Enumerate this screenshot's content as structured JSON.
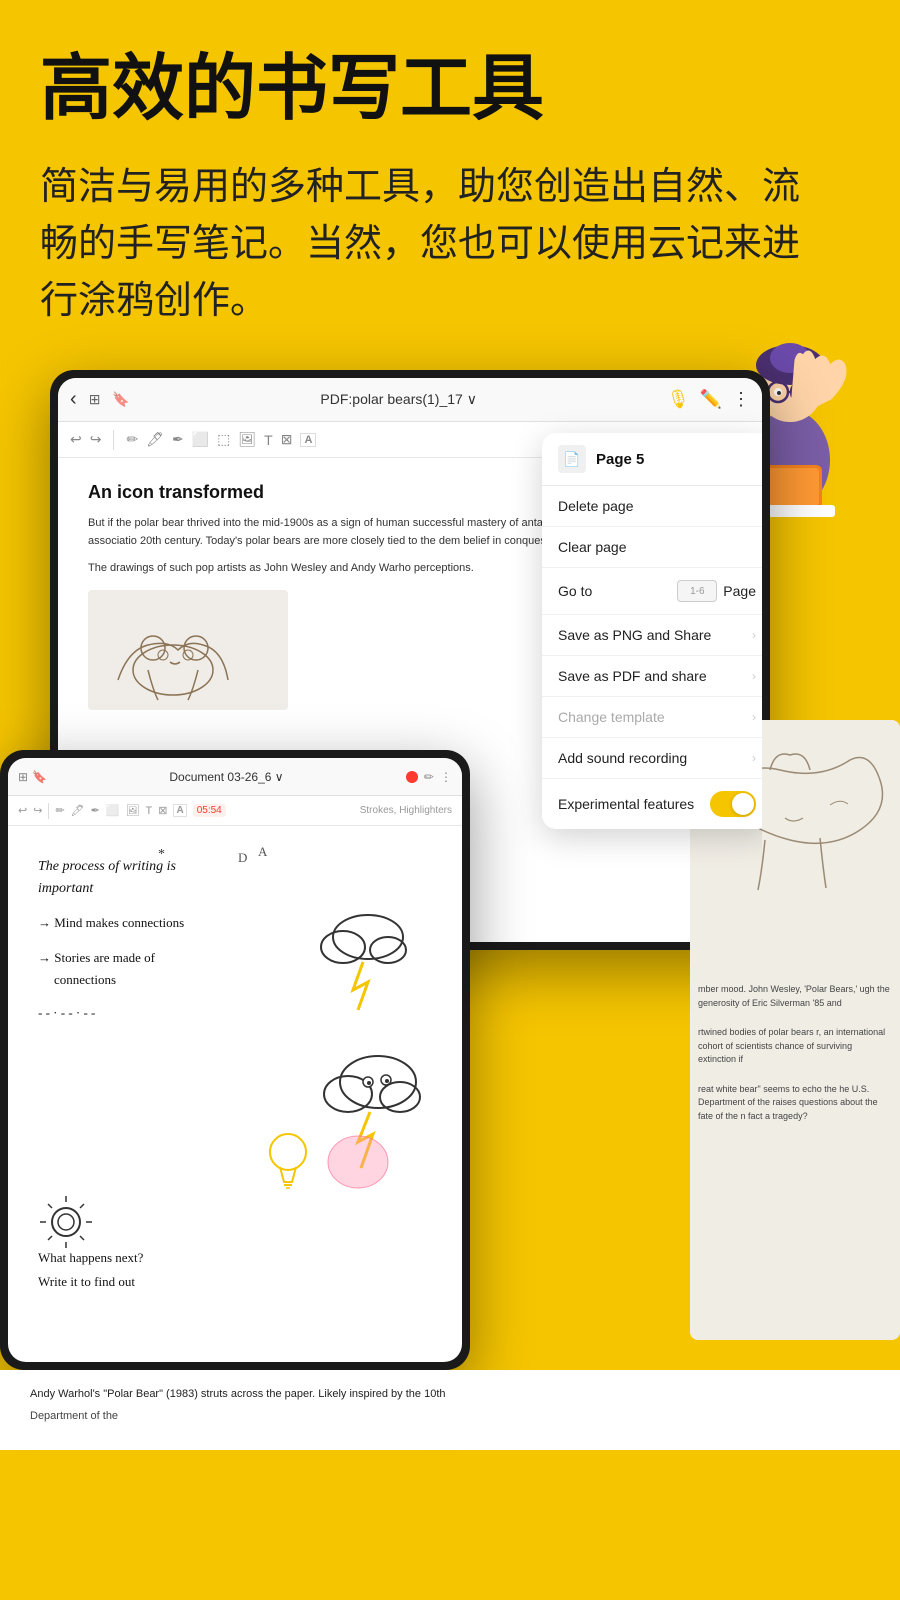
{
  "hero": {
    "title": "高效的书写工具",
    "description": "简洁与易用的多种工具，助您创造出自然、流畅的手写笔记。当然，您也可以使用云记来进行涂鸦创作。"
  },
  "toolbar": {
    "back_icon": "‹",
    "title": "PDF:polar bears(1)_17 ∨",
    "mic_icon": "🎙",
    "pen_icon": "✏",
    "dots_icon": "⋮"
  },
  "context_menu": {
    "header_title": "Page 5",
    "items": [
      {
        "label": "Delete page",
        "type": "normal",
        "right": ""
      },
      {
        "label": "Clear page",
        "type": "normal",
        "right": ""
      },
      {
        "label": "Go to",
        "type": "goto",
        "placeholder": "1-6",
        "page_label": "Page"
      },
      {
        "label": "Save as PNG and Share",
        "type": "arrow",
        "right": "›"
      },
      {
        "label": "Save as PDF and share",
        "type": "arrow",
        "right": "›"
      },
      {
        "label": "Change template",
        "type": "disabled_arrow",
        "right": "›"
      },
      {
        "label": "Add sound recording",
        "type": "arrow",
        "right": "›"
      },
      {
        "label": "Experimental features",
        "type": "toggle"
      }
    ]
  },
  "document": {
    "title": "An icon transformed",
    "paragraph1": "But if the polar bear thrived into the mid-1900s as a sign of human successful mastery of antagonistic forces, this symbolic associatio 20th century. Today's polar bears are more closely tied to the dem belief in conquest and domination.",
    "paragraph2": "The drawings of such pop artists as John Wesley and Andy Warho perceptions."
  },
  "second_tablet": {
    "title": "Document 03-26_6 ∨",
    "timer": "05:54",
    "strokes_label": "Strokes, Highlighters",
    "handwriting_lines": [
      "The process of writing is",
      "important",
      "→ Mind makes connections",
      "→ Stories are made of",
      "   connections",
      "- - · - - · - -",
      "What happens next?",
      "Write it to find out"
    ]
  },
  "pdf_panel": {
    "text1": "mber mood. John Wesley, 'Polar Bears,' ugh the generosity of Eric Silverman '85 and",
    "text2": "rtwined bodies of polar bears r, an international cohort of scientists chance of surviving extinction if",
    "text3": "reat white bear\" seems to echo the he U.S. Department of the raises questions about the fate of the n fact a tragedy?"
  },
  "bottom_citation": "Andy Warhol's \"Polar Bear\" (1983) struts across the paper. Likely inspired by the 10th"
}
